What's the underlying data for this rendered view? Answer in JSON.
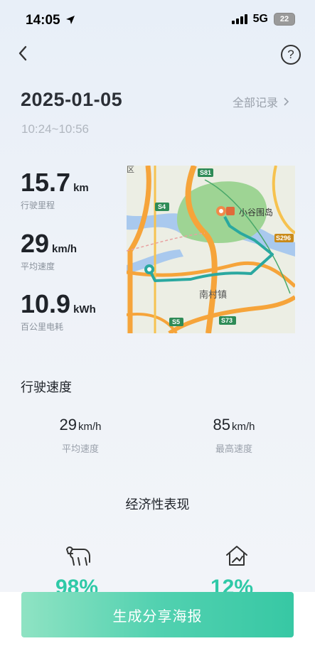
{
  "status_bar": {
    "time": "14:05",
    "network": "5G",
    "battery": "22"
  },
  "header": {
    "help_symbol": "?"
  },
  "trip": {
    "date": "2025-01-05",
    "time_range": "10:24~10:56",
    "all_records_label": "全部记录",
    "metrics": [
      {
        "value": "15.7",
        "unit": "km",
        "label": "行驶里程"
      },
      {
        "value": "29",
        "unit": "km/h",
        "label": "平均速度"
      },
      {
        "value": "10.9",
        "unit": "kWh",
        "label": "百公里电耗"
      }
    ]
  },
  "map": {
    "place_label": "小谷围岛",
    "town_label": "南村镇",
    "road_labels": [
      "S81",
      "S4",
      "S296",
      "S5",
      "S73"
    ],
    "edge_label": "区"
  },
  "speed_section": {
    "title": "行驶速度",
    "avg": {
      "value": "29",
      "unit": "km/h",
      "label": "平均速度"
    },
    "max": {
      "value": "85",
      "unit": "km/h",
      "label": "最高速度"
    }
  },
  "economy_section": {
    "title": "经济性表现",
    "items": [
      {
        "value": "98%",
        "icon": "bull-icon"
      },
      {
        "value": "12%",
        "icon": "house-chart-icon"
      }
    ]
  },
  "share_button": {
    "label": "生成分享海报"
  },
  "colors": {
    "accent": "#37c8a4",
    "route": "#2aa8a0"
  }
}
